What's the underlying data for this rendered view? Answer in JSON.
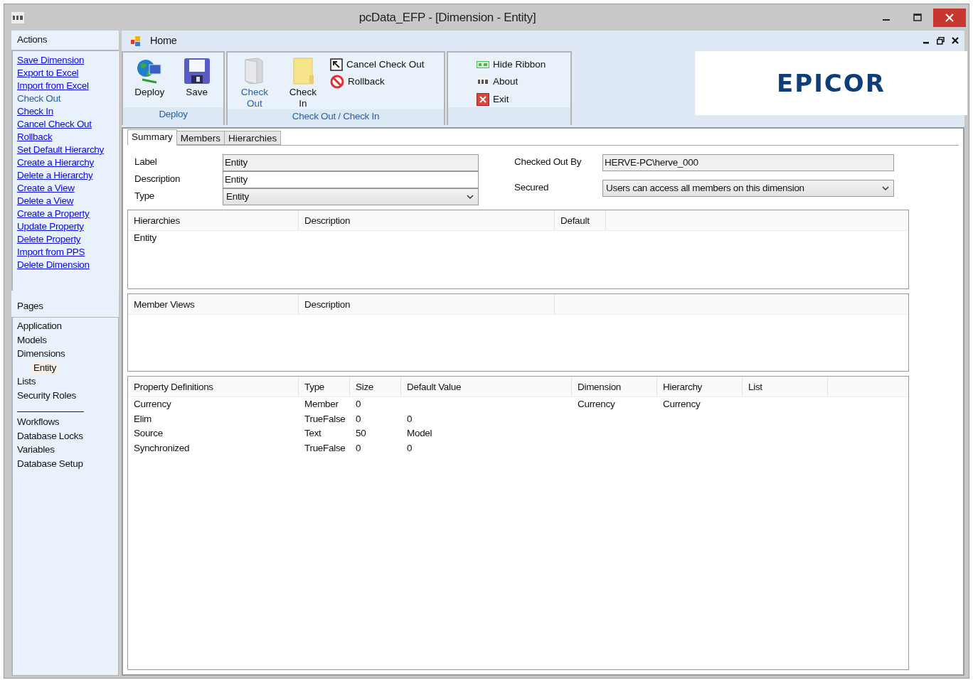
{
  "window": {
    "title": "pcData_EFP - [Dimension - Entity]"
  },
  "actions": {
    "title": "Actions",
    "items": [
      {
        "label": "Save Dimension",
        "enabled": true
      },
      {
        "label": "Export to Excel",
        "enabled": true
      },
      {
        "label": "Import from Excel",
        "enabled": true
      },
      {
        "label": "Check Out",
        "enabled": false
      },
      {
        "label": "Check In",
        "enabled": true
      },
      {
        "label": "Cancel Check Out",
        "enabled": true
      },
      {
        "label": "Rollback",
        "enabled": true
      },
      {
        "label": "Set Default Hierarchy",
        "enabled": true
      },
      {
        "label": "Create a Hierarchy",
        "enabled": true
      },
      {
        "label": "Delete a Hierarchy",
        "enabled": true
      },
      {
        "label": "Create a View",
        "enabled": true
      },
      {
        "label": "Delete a View",
        "enabled": true
      },
      {
        "label": "Create a Property",
        "enabled": true
      },
      {
        "label": "Update Property",
        "enabled": true
      },
      {
        "label": "Delete Property",
        "enabled": true
      },
      {
        "label": "Import from PPS",
        "enabled": true
      },
      {
        "label": "Delete Dimension",
        "enabled": true
      }
    ]
  },
  "pages": {
    "title": "Pages",
    "items": [
      {
        "label": "Application",
        "selected": false
      },
      {
        "label": "Models",
        "selected": false
      },
      {
        "label": "Dimensions",
        "selected": false,
        "children": [
          {
            "label": "Entity",
            "selected": true
          }
        ]
      },
      {
        "label": "Lists",
        "selected": false
      },
      {
        "label": "Security Roles",
        "selected": false
      }
    ],
    "more_items": [
      {
        "label": "Workflows",
        "selected": false
      },
      {
        "label": "Database Locks",
        "selected": false
      },
      {
        "label": "Variables",
        "selected": false
      },
      {
        "label": "Database Setup",
        "selected": false
      }
    ]
  },
  "ribbon": {
    "tab": "Home",
    "groups": [
      {
        "label": "Deploy",
        "buttons": [
          {
            "label": "Deploy",
            "kind": "large",
            "disabled": false
          },
          {
            "label": "Save",
            "kind": "large",
            "disabled": false
          }
        ]
      },
      {
        "label": "Check Out / Check In",
        "buttons": [
          {
            "label": "Check Out",
            "kind": "large",
            "disabled": true
          },
          {
            "label": "Check In",
            "kind": "large",
            "disabled": false
          },
          {
            "label": "Cancel Check Out",
            "kind": "small"
          },
          {
            "label": "Rollback",
            "kind": "small"
          }
        ]
      },
      {
        "buttons": [
          {
            "label": "Hide Ribbon",
            "kind": "small"
          },
          {
            "label": "About",
            "kind": "small"
          },
          {
            "label": "Exit",
            "kind": "small"
          }
        ]
      }
    ],
    "logo": "EPICOR"
  },
  "tabs": [
    {
      "label": "Summary",
      "selected": true
    },
    {
      "label": "Members",
      "selected": false
    },
    {
      "label": "Hierarchies",
      "selected": false
    }
  ],
  "summary": {
    "left": [
      {
        "label": "Label",
        "kind": "readonly",
        "value": "Entity"
      },
      {
        "label": "Description",
        "kind": "text",
        "value": "Entity"
      },
      {
        "label": "Type",
        "kind": "select",
        "value": "Entity"
      }
    ],
    "right": [
      {
        "label": "Checked Out By",
        "kind": "readonly",
        "value": "HERVE-PC\\herve_000"
      },
      {
        "label": "Secured",
        "kind": "select",
        "value": "Users can access all members on this dimension"
      }
    ]
  },
  "grids": [
    {
      "columns": [
        "Hierarchies",
        "Description",
        "Default"
      ],
      "rows": [
        [
          "Entity",
          "",
          ""
        ]
      ]
    },
    {
      "columns": [
        "Member Views",
        "Description"
      ]
    },
    {
      "columns": [
        "Property Definitions",
        "Type",
        "Size",
        "Default Value",
        "Dimension",
        "Hierarchy",
        "List"
      ],
      "rows": [
        [
          "Currency",
          "Member",
          "0",
          "",
          "Currency",
          "Currency",
          ""
        ],
        [
          "Elim",
          "TrueFalse",
          "0",
          "0",
          "",
          "",
          ""
        ],
        [
          "Source",
          "Text",
          "50",
          "Model",
          "",
          "",
          ""
        ],
        [
          "Synchronized",
          "TrueFalse",
          "0",
          "0",
          "",
          "",
          ""
        ]
      ]
    }
  ]
}
